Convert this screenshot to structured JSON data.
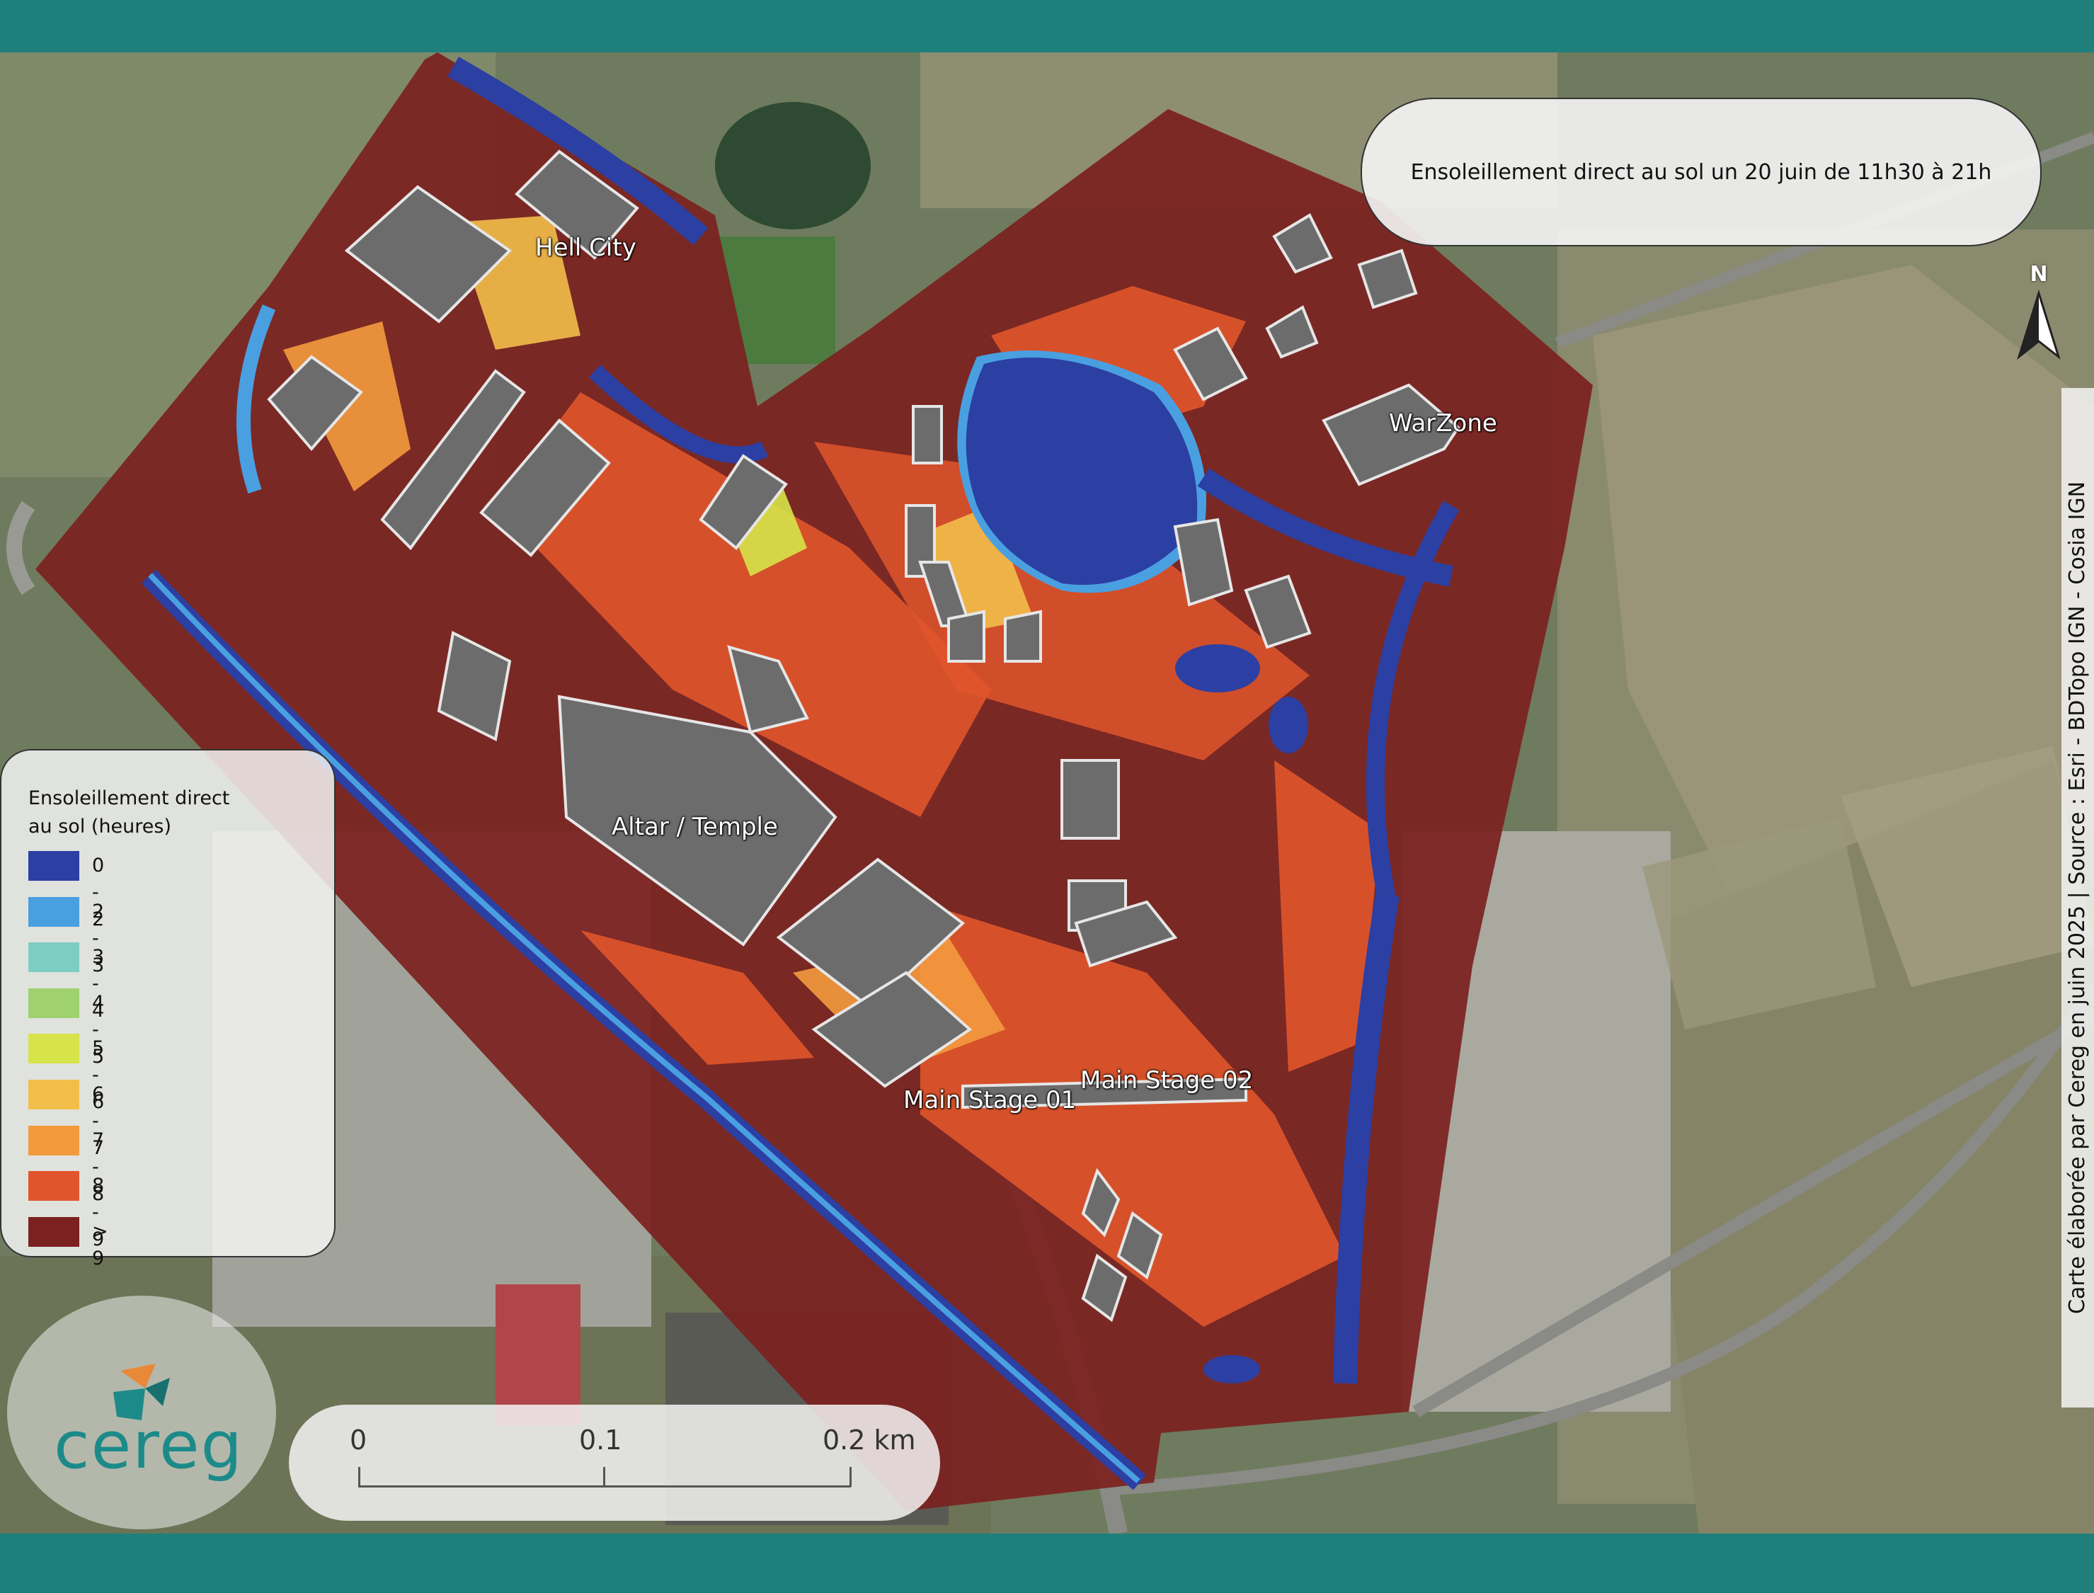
{
  "title": "Ensoleillement direct au sol un 20 juin de 11h30 à 21h",
  "credits": "Carte élaborée par Cereg en juin 2025  |  Source : Esri - BDTopo IGN - Cosia IGN",
  "north_label": "N",
  "legend": {
    "title": "Ensoleillement direct\nau sol (heures)",
    "items": [
      {
        "label": "0 - 2",
        "color": "#2c3fa3"
      },
      {
        "label": "2 - 3",
        "color": "#4a9fe0"
      },
      {
        "label": "3 - 4",
        "color": "#7ecdc2"
      },
      {
        "label": "4 - 5",
        "color": "#9fd16e"
      },
      {
        "label": "5 - 6",
        "color": "#d6e34a"
      },
      {
        "label": "6 - 7",
        "color": "#f2be4a"
      },
      {
        "label": "7 - 8",
        "color": "#f39a3e"
      },
      {
        "label": "8 - 9",
        "color": "#e0552b"
      },
      {
        "label": "> 9",
        "color": "#7b2120"
      }
    ]
  },
  "scale": {
    "labels": [
      "0",
      "0.1",
      "0.2 km"
    ]
  },
  "places": {
    "hell_city": "Hell City",
    "warzone": "WarZone",
    "altar_temple": "Altar / Temple",
    "main_stage_01": "Main Stage 01",
    "main_stage_02": "Main Stage 02"
  },
  "logo": {
    "text": "cereg"
  }
}
